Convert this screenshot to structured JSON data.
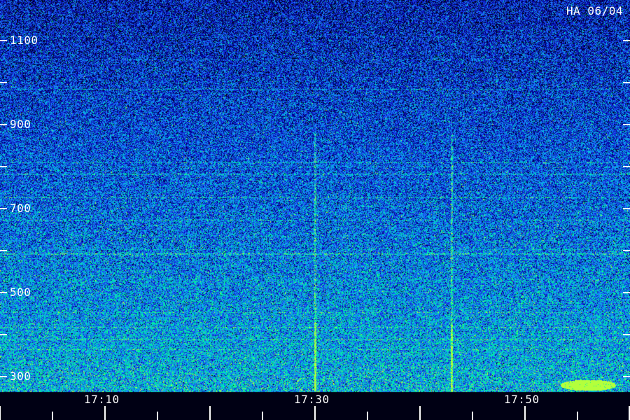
{
  "title": "HA 06/04",
  "chart_data": {
    "type": "heatmap",
    "title": "HA 06/04",
    "xlabel": "",
    "ylabel": "",
    "x_tick_labels": [
      "17:10",
      "17:30",
      "17:50"
    ],
    "x_range_minutes": [
      "17:00",
      "17:59"
    ],
    "y_tick_labels": [
      "1100",
      "900",
      "700",
      "500",
      "300"
    ],
    "y_tick_values": [
      1100,
      900,
      700,
      500,
      300
    ],
    "y_range": [
      260,
      1260
    ],
    "grid": false,
    "colormap": [
      "#000014",
      "#00008c",
      "#1428dc",
      "#1e78ff",
      "#00c8dc",
      "#00ff8c",
      "#b4ff3c"
    ],
    "features": {
      "vertical_bursts_time": [
        "17:30",
        "17:43"
      ],
      "hot_patch_time": "17:56",
      "hot_patch_freq": 280
    }
  }
}
